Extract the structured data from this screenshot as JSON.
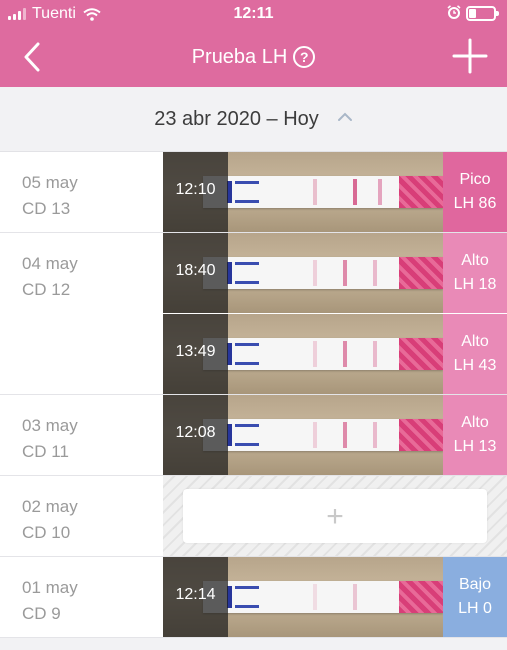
{
  "status_bar": {
    "carrier": "Tuenti",
    "time": "12:11"
  },
  "header": {
    "title": "Prueba LH",
    "help_symbol": "?",
    "color": "#de6b9f"
  },
  "date_range": {
    "label": "23 abr 2020 – Hoy"
  },
  "colors": {
    "peak": "#e0679e",
    "high": "#e98ab7",
    "low": "#8aaedf"
  },
  "days": [
    {
      "date": "05 may",
      "cd": "CD 13",
      "entries": [
        {
          "time": "12:10",
          "level": "Pico",
          "value": "LH 86",
          "kind": "peak"
        }
      ]
    },
    {
      "date": "04 may",
      "cd": "CD 12",
      "entries": [
        {
          "time": "18:40",
          "level": "Alto",
          "value": "LH 18",
          "kind": "high"
        },
        {
          "time": "13:49",
          "level": "Alto",
          "value": "LH 43",
          "kind": "high"
        }
      ]
    },
    {
      "date": "03 may",
      "cd": "CD 11",
      "entries": [
        {
          "time": "12:08",
          "level": "Alto",
          "value": "LH 13",
          "kind": "high"
        }
      ]
    },
    {
      "date": "02 may",
      "cd": "CD 10",
      "entries": [],
      "add_symbol": "+"
    },
    {
      "date": "01 may",
      "cd": "CD 9",
      "entries": [
        {
          "time": "12:14",
          "level": "Bajo",
          "value": "LH 0",
          "kind": "low"
        }
      ]
    }
  ]
}
